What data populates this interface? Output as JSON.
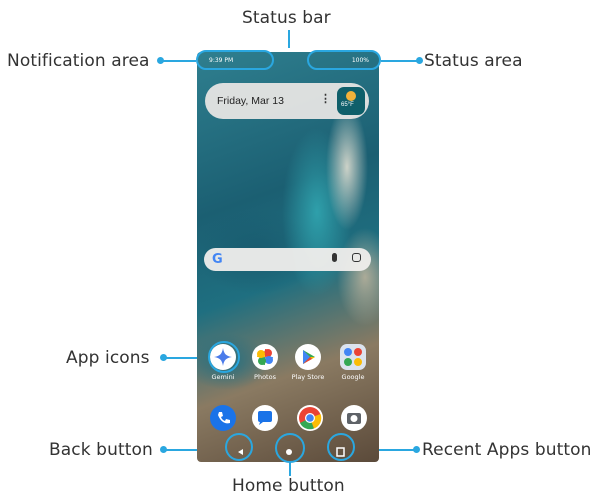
{
  "callouts": {
    "status_bar": "Status bar",
    "notification_area": "Notification area",
    "status_area": "Status area",
    "app_icons": "App icons",
    "back_button": "Back button",
    "home_button": "Home button",
    "recent_apps_button": "Recent Apps button"
  },
  "status_bar": {
    "time": "9:39 PM",
    "right": "100%"
  },
  "date_widget": {
    "date": "Friday, Mar 13",
    "menu": "⋮",
    "temperature": "65°F"
  },
  "search": {
    "logo": "G"
  },
  "apps": [
    {
      "label": "Gemini"
    },
    {
      "label": "Photos"
    },
    {
      "label": "Play Store"
    },
    {
      "label": "Google"
    }
  ],
  "colors": {
    "callout": "#2aa7e0"
  }
}
